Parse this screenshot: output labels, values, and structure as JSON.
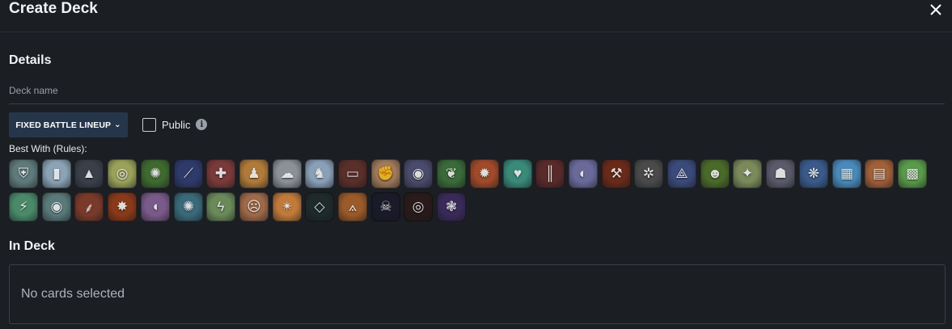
{
  "header": {
    "title": "Create Deck",
    "close_icon": "close-icon"
  },
  "details": {
    "title": "Details",
    "deck_name_placeholder": "Deck name",
    "lineup_button": "FIXED BATTLE LINEUP",
    "public_label": "Public",
    "public_checked": false
  },
  "rules": {
    "label": "Best With (Rules):",
    "icons": [
      {
        "name": "armored-up-icon",
        "bg": "#5f7a7a",
        "glyph": "⛨"
      },
      {
        "name": "back-to-basics-icon",
        "bg": "#8aa3b5",
        "glyph": "▮"
      },
      {
        "name": "hooded-figure-icon",
        "bg": "#3a3f4a",
        "glyph": "▲"
      },
      {
        "name": "target-icon",
        "bg": "#9aa25a",
        "glyph": "◎"
      },
      {
        "name": "green-swirl-icon",
        "bg": "#3f6a2f",
        "glyph": "✺"
      },
      {
        "name": "blue-slash-icon",
        "bg": "#2e3a6a",
        "glyph": "⟋"
      },
      {
        "name": "shield-cross-icon",
        "bg": "#7a3a3a",
        "glyph": "✚"
      },
      {
        "name": "golden-figure-icon",
        "bg": "#b07a3a",
        "glyph": "♟"
      },
      {
        "name": "cloud-icon",
        "bg": "#8c9098",
        "glyph": "☁"
      },
      {
        "name": "helmet-icon",
        "bg": "#8aa0b8",
        "glyph": "♞"
      },
      {
        "name": "bandage-icon",
        "bg": "#5a2f2a",
        "glyph": "▭"
      },
      {
        "name": "gauntlet-icon",
        "bg": "#a07a5a",
        "glyph": "✊"
      },
      {
        "name": "eye-swirl-icon",
        "bg": "#4a4a6a",
        "glyph": "◉"
      },
      {
        "name": "green-dragon-icon",
        "bg": "#3a6a3a",
        "glyph": "❦"
      },
      {
        "name": "fire-fist-icon",
        "bg": "#a04a2a",
        "glyph": "✹"
      },
      {
        "name": "heal-arrow-icon",
        "bg": "#3a8a7a",
        "glyph": "♥"
      },
      {
        "name": "prison-bars-icon",
        "bg": "#5a2a2a",
        "glyph": "║"
      },
      {
        "name": "ghost-icon",
        "bg": "#6a6a9a",
        "glyph": "◐"
      },
      {
        "name": "hammer-icon",
        "bg": "#6a2a1a",
        "glyph": "⚒"
      },
      {
        "name": "color-wheel-icon",
        "bg": "#4a4a4a",
        "glyph": "✲"
      },
      {
        "name": "white-dragon-icon",
        "bg": "#3a4a7a",
        "glyph": "⟁"
      },
      {
        "name": "goblin-icon",
        "bg": "#4a6a2a",
        "glyph": "☻"
      },
      {
        "name": "spark-staff-icon",
        "bg": "#7a8a5a",
        "glyph": "✦"
      },
      {
        "name": "shaman-icon",
        "bg": "#5a5a6a",
        "glyph": "☗"
      },
      {
        "name": "blue-burst-icon",
        "bg": "#3a5a8a",
        "glyph": "❋"
      },
      {
        "name": "card-fan-icon",
        "bg": "#4a8aba",
        "glyph": "▦"
      },
      {
        "name": "card-stack-icon",
        "bg": "#a0603a",
        "glyph": "▤"
      },
      {
        "name": "green-blocks-icon",
        "bg": "#5a9a4a",
        "glyph": "▩"
      },
      {
        "name": "lightning-tower-icon",
        "bg": "#4a8a6a",
        "glyph": "⚡"
      },
      {
        "name": "watching-eye-icon",
        "bg": "#5a7a7a",
        "glyph": "◉"
      },
      {
        "name": "blood-claw-icon",
        "bg": "#7a3a2a",
        "glyph": "⸙"
      },
      {
        "name": "fire-explosion-icon",
        "bg": "#8a3a1a",
        "glyph": "✸"
      },
      {
        "name": "purple-shield-icon",
        "bg": "#7a5a8a",
        "glyph": "◖"
      },
      {
        "name": "sun-burst-icon",
        "bg": "#3a6a7a",
        "glyph": "✺"
      },
      {
        "name": "lightning-bolt-icon",
        "bg": "#6a8a5a",
        "glyph": "ϟ"
      },
      {
        "name": "ogre-icon",
        "bg": "#a06a4a",
        "glyph": "☹"
      },
      {
        "name": "yellow-spark-icon",
        "bg": "#c07a3a",
        "glyph": "✴"
      },
      {
        "name": "diamond-frame-icon",
        "bg": "#1f2a2a",
        "glyph": "◇"
      },
      {
        "name": "red-wing-icon",
        "bg": "#9a5a2a",
        "glyph": "⟑"
      },
      {
        "name": "skeleton-icon",
        "bg": "#1a1a2a",
        "glyph": "☠"
      },
      {
        "name": "red-target-icon",
        "bg": "#2a1a1a",
        "glyph": "◎"
      },
      {
        "name": "purple-burst-icon",
        "bg": "#3a2a5a",
        "glyph": "❃"
      }
    ]
  },
  "in_deck": {
    "title": "In Deck",
    "empty_text": "No cards selected"
  }
}
